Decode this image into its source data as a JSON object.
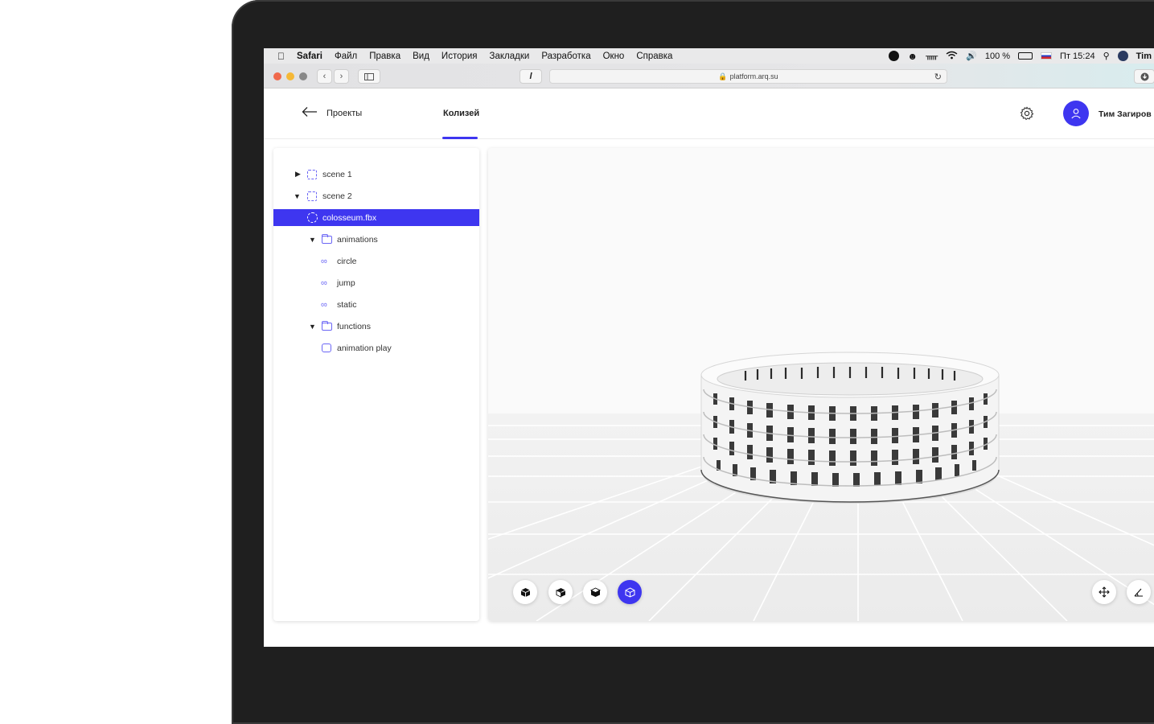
{
  "menubar": {
    "apple": "",
    "app": "Safari",
    "items": [
      "Файл",
      "Правка",
      "Вид",
      "История",
      "Закладки",
      "Разработка",
      "Окно",
      "Справка"
    ],
    "battery": "100 %",
    "clock": "Пт 15:24",
    "user": "Tim"
  },
  "browser": {
    "url": "platform.arq.su",
    "tab_glyph": "l"
  },
  "header": {
    "back_label": "Проекты",
    "active_tab": "Колизей",
    "user_name": "Тим Загиров"
  },
  "tree": {
    "items": [
      {
        "label": "scene 1",
        "icon": "scene-icon",
        "expanded": false
      },
      {
        "label": "scene 2",
        "icon": "scene-icon",
        "expanded": true
      },
      {
        "label": "colosseum.fbx",
        "icon": "model-icon",
        "selected": true
      },
      {
        "label": "animations",
        "icon": "folder-icon",
        "expanded": true
      },
      {
        "label": "circle",
        "icon": "animation-icon"
      },
      {
        "label": "jump",
        "icon": "animation-icon"
      },
      {
        "label": "static",
        "icon": "animation-icon"
      },
      {
        "label": "functions",
        "icon": "folder-icon",
        "expanded": true
      },
      {
        "label": "animation play",
        "icon": "function-icon"
      }
    ]
  },
  "viewport": {
    "view_buttons": [
      "cube-view-front-icon",
      "cube-view-side-icon",
      "cube-view-top-icon",
      "cube-view-perspective-icon"
    ],
    "active_view": 3,
    "tools": [
      "move-icon",
      "measure-icon"
    ]
  },
  "colors": {
    "accent": "#3e36f0",
    "floor": "#efefef",
    "grid": "#ffffff"
  }
}
